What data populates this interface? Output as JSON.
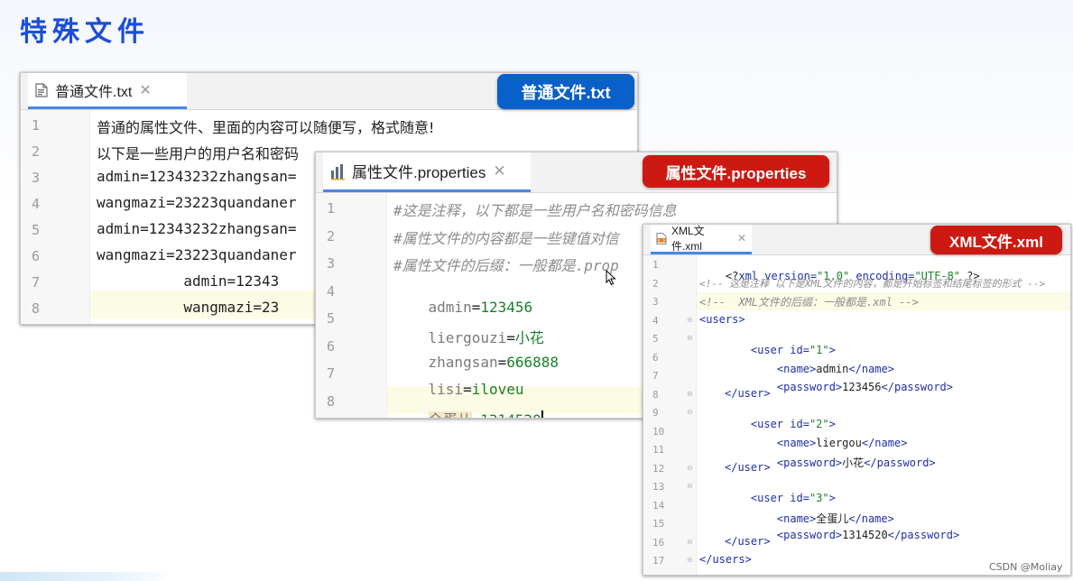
{
  "slide": {
    "title": "特殊文件",
    "watermark": "CSDN @Moliay"
  },
  "colors": {
    "badge_txt": "#0a60c9",
    "badge_prop": "#cc1a12",
    "badge_xml": "#cc1a12",
    "tab_underline": "#4a86e8"
  },
  "txt_editor": {
    "tab_title": "普通文件.txt",
    "badge": "普通文件.txt",
    "line_numbers": [
      "1",
      "2",
      "3",
      "4",
      "5",
      "6",
      "7",
      "8"
    ],
    "lines": [
      "普通的属性文件、里面的内容可以随便写，格式随意!",
      "以下是一些用户的用户名和密码",
      "admin=12343232zhangsan=",
      "wangmazi=23223quandaner",
      "admin=12343232zhangsan=",
      "wangmazi=23223quandaner",
      "          admin=12343",
      "          wangmazi=23"
    ]
  },
  "prop_editor": {
    "tab_title": "属性文件.properties",
    "badge": "属性文件.properties",
    "line_numbers": [
      "1",
      "2",
      "3",
      "4",
      "5",
      "6",
      "7",
      "8"
    ],
    "comments": [
      "#这是注释，以下都是一些用户名和密码信息",
      "#属性文件的内容都是一些键值对信",
      "#属性文件的后缀：一般都是.prop"
    ],
    "entries": [
      {
        "key": "admin",
        "eq": "=",
        "value": "123456"
      },
      {
        "key": "liergouzi",
        "eq": "=",
        "value": "小花"
      },
      {
        "key": "zhangsan",
        "eq": "=",
        "value": "666888"
      },
      {
        "key": "lisi",
        "eq": "=",
        "value": "iloveu"
      },
      {
        "key": "全蛋儿",
        "eq": "=",
        "value": "1314520"
      }
    ]
  },
  "xml_editor": {
    "tab_title": "XML文件.xml",
    "badge": "XML文件.xml",
    "line_numbers": [
      "1",
      "2",
      "3",
      "4",
      "5",
      "6",
      "7",
      "8",
      "9",
      "10",
      "11",
      "12",
      "13",
      "14",
      "15",
      "16",
      "17"
    ],
    "decl": {
      "open": "<?",
      "name": "xml",
      "attr1": " version=",
      "val1": "\"1.0\"",
      "attr2": " encoding=",
      "val2": "\"UTF-8\"",
      "close": " ?>"
    },
    "comment1": "<!-- 这是注释 以下是XML文件的内容，都是开始标签和结尾标签的形式 -->",
    "comment2": "<!--  XML文件的后缀：一般都是.xml -->",
    "users_open": "<users>",
    "users_close": "</users>",
    "users": [
      {
        "open_tag": "<user",
        "id_attr": " id=",
        "id_val": "\"1\"",
        "gt": ">",
        "name": "admin",
        "password": "123456"
      },
      {
        "open_tag": "<user",
        "id_attr": " id=",
        "id_val": "\"2\"",
        "gt": ">",
        "name": "liergou",
        "password": "小花"
      },
      {
        "open_tag": "<user",
        "id_attr": " id=",
        "id_val": "\"3\"",
        "gt": ">",
        "name": "全蛋儿",
        "password": "1314520"
      }
    ],
    "tags": {
      "name_open": "<name>",
      "name_close": "</name>",
      "pwd_open": "<password>",
      "pwd_close": "</password>",
      "user_close": "</user>"
    }
  }
}
